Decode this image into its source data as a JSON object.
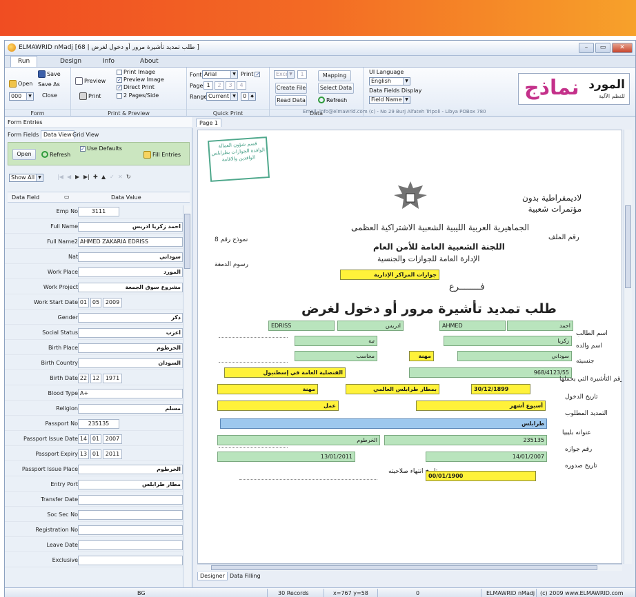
{
  "window": {
    "title": "ELMAWRID nMadj [68 | طلب تمديد تأشيرة مرور أو دخول لغرض ]",
    "controls": [
      "–",
      "▭",
      "✕"
    ]
  },
  "ribbon_tabs": [
    "Run",
    "Design",
    "Info",
    "About"
  ],
  "ribbon": {
    "form": {
      "open": "Open",
      "save": "Save",
      "save_as": "Save As",
      "close": "Close",
      "combo_value": "000",
      "label": "Form"
    },
    "print_preview": {
      "preview": "Preview",
      "print": "Print",
      "opt_print_image": "Print Image",
      "opt_preview_image": "Preview Image",
      "opt_direct_print": "Direct Print",
      "opt_two_pages": "2 Pages/Side",
      "label": "Print & Preview"
    },
    "quick_print": {
      "font_label": "Font",
      "font_value": "Arial",
      "print_label": "Print",
      "page_label": "Page",
      "pages": [
        "1",
        "2",
        "3",
        "4"
      ],
      "range_label": "Range",
      "range_value": "Current",
      "range_num": "0",
      "label": "Quick Print"
    },
    "data": {
      "excel_value": "Excel",
      "excel_num": "1",
      "create_file": "Create File",
      "read_data": "Read Data",
      "mapping": "Mapping",
      "select_data": "Select Data",
      "refresh": "Refresh",
      "label": "Data"
    },
    "ui": {
      "language_label": "UI Language",
      "language_value": "English",
      "fields_display_label": "Data Fields Display",
      "fields_display_value": "Field Name"
    },
    "email_line": "Email: info@elmawrid.com (c) - No 29 Burj Alfateh Tripoli - Libya POBox 780"
  },
  "logo": {
    "big": "نماذج",
    "small": "المورد",
    "tag": "للنظم الآلية"
  },
  "left_pane": {
    "header": "Form Entries",
    "tabs": [
      "Form Fields",
      "Data View",
      "Grid View"
    ],
    "open": "Open",
    "refresh": "Refresh",
    "use_defaults": "Use Defaults",
    "fill_entries": "Fill Entries",
    "show_all": "Show All",
    "col_field": "Data Field",
    "col_value": "Data Value",
    "fields": [
      {
        "label": "Emp No",
        "value": "3111",
        "kind": "num"
      },
      {
        "label": "Full Name",
        "value": "احمد زكريا ادريس",
        "kind": "rtl"
      },
      {
        "label": "Full Name2",
        "value": "AHMED ZAKARIA EDRISS",
        "kind": "text"
      },
      {
        "label": "Nat",
        "value": "سوداني",
        "kind": "rtl"
      },
      {
        "label": "Work Place",
        "value": "المورد",
        "kind": "rtl"
      },
      {
        "label": "Work Project",
        "value": "مشروع سوق الجمعة",
        "kind": "rtl"
      },
      {
        "label": "Work Start Date",
        "value": [
          "01",
          "05",
          "2009"
        ],
        "kind": "date"
      },
      {
        "label": "Gender",
        "value": "ذكر",
        "kind": "rtl"
      },
      {
        "label": "Social Status",
        "value": "اعزب",
        "kind": "rtl"
      },
      {
        "label": "Birth Place",
        "value": "الخرطوم",
        "kind": "rtl"
      },
      {
        "label": "Birth Country",
        "value": "السودان",
        "kind": "rtl"
      },
      {
        "label": "Birth Date",
        "value": [
          "22",
          "12",
          "1971"
        ],
        "kind": "date"
      },
      {
        "label": "Blood Type",
        "value": "A+",
        "kind": "text"
      },
      {
        "label": "Religion",
        "value": "مسلم",
        "kind": "rtl"
      },
      {
        "label": "Passport No",
        "value": "235135",
        "kind": "num"
      },
      {
        "label": "Passport Issue Date",
        "value": [
          "14",
          "01",
          "2007"
        ],
        "kind": "date"
      },
      {
        "label": "Passport Expiry",
        "value": [
          "13",
          "01",
          "2011"
        ],
        "kind": "date"
      },
      {
        "label": "Passport Issue Place",
        "value": "الخرطوم",
        "kind": "rtl"
      },
      {
        "label": "Entry Port",
        "value": "مطار طرابلس",
        "kind": "rtl"
      },
      {
        "label": "Transfer Date",
        "value": "",
        "kind": "text"
      },
      {
        "label": "Soc Sec No",
        "value": "",
        "kind": "text"
      },
      {
        "label": "Registration No",
        "value": "",
        "kind": "text"
      },
      {
        "label": "Leave Date",
        "value": "",
        "kind": "text"
      },
      {
        "label": "Exclusive",
        "value": "",
        "kind": "text"
      }
    ]
  },
  "right_pane": {
    "page_tab": "Page 1",
    "bottom_tabs": [
      "Designer",
      "Data Filling"
    ]
  },
  "document": {
    "stamp": "قسم شؤون العمالة الوافدة الجوازات بطرابلس الوافدين والاقامة",
    "slogan": "لاديمقراطية بدون\nمؤتمرات شعبية",
    "state_name": "الجماهيرية العربية الليبية الشعبية الاشتراكية العظمى",
    "committee": "اللجنة الشعبية العامة للأمن العام",
    "department": "الإدارة العامة للجوازات والجنسية",
    "branch_label": "فــــــــرع",
    "branch_value": "جوازات المراكز الإدارية",
    "model_no": "نموذج رقم 8",
    "stamp_fees": "رسوم الدمغة",
    "file_no": "رقم الملف",
    "form_title": "طلب تمديد تأشيرة مرور أو دخول لغرض",
    "labels": {
      "applicant": "اسم الطالب",
      "father": "اسم والده",
      "nationality": "جنسيته",
      "visa_no": "رقم التأشيرة التي يحملها",
      "entry_date": "تاريخ الدخول",
      "extension": "التمديد المطلوب",
      "libya_address": "عنوانه بليبيا",
      "passport_no": "رقم جوازه",
      "issue_date": "تاريخ صدوره",
      "expiry_date": "تاريخ انتهاء صلاحيته"
    },
    "cells": {
      "name_en_last": "EDRISS",
      "name_ar_last": "ادريس",
      "name_en_first": "AHMED",
      "name_ar_first": "احمد",
      "father": "زكريا",
      "nationality_a": "تبة",
      "profession": "محاسب",
      "mother_label": "مهنة",
      "sudanese": "سوداني",
      "visa_no": "968/4123/55",
      "visa_office": "القنصلية العامة في إسطنبول",
      "entry_port": "بمطار طرابلس العالمي",
      "entry_label": "مهنة",
      "entry_date": "30/12/1899",
      "extension_period": "أسبوع أشهر",
      "purpose": "عمل",
      "address": "طرابلس",
      "issue_place": "الخرطوم",
      "passport_no": "235135",
      "expiry": "13/01/2011",
      "issue_date": "14/01/2007",
      "last_row": "00/01/1900"
    }
  },
  "status_bar": {
    "left": "BG",
    "records": "30 Records",
    "coords": "x=767 y=58",
    "zero": "0",
    "app": "ELMAWRID nMadj",
    "copyright": "(c) 2009 www.ELMAWRID.com"
  }
}
